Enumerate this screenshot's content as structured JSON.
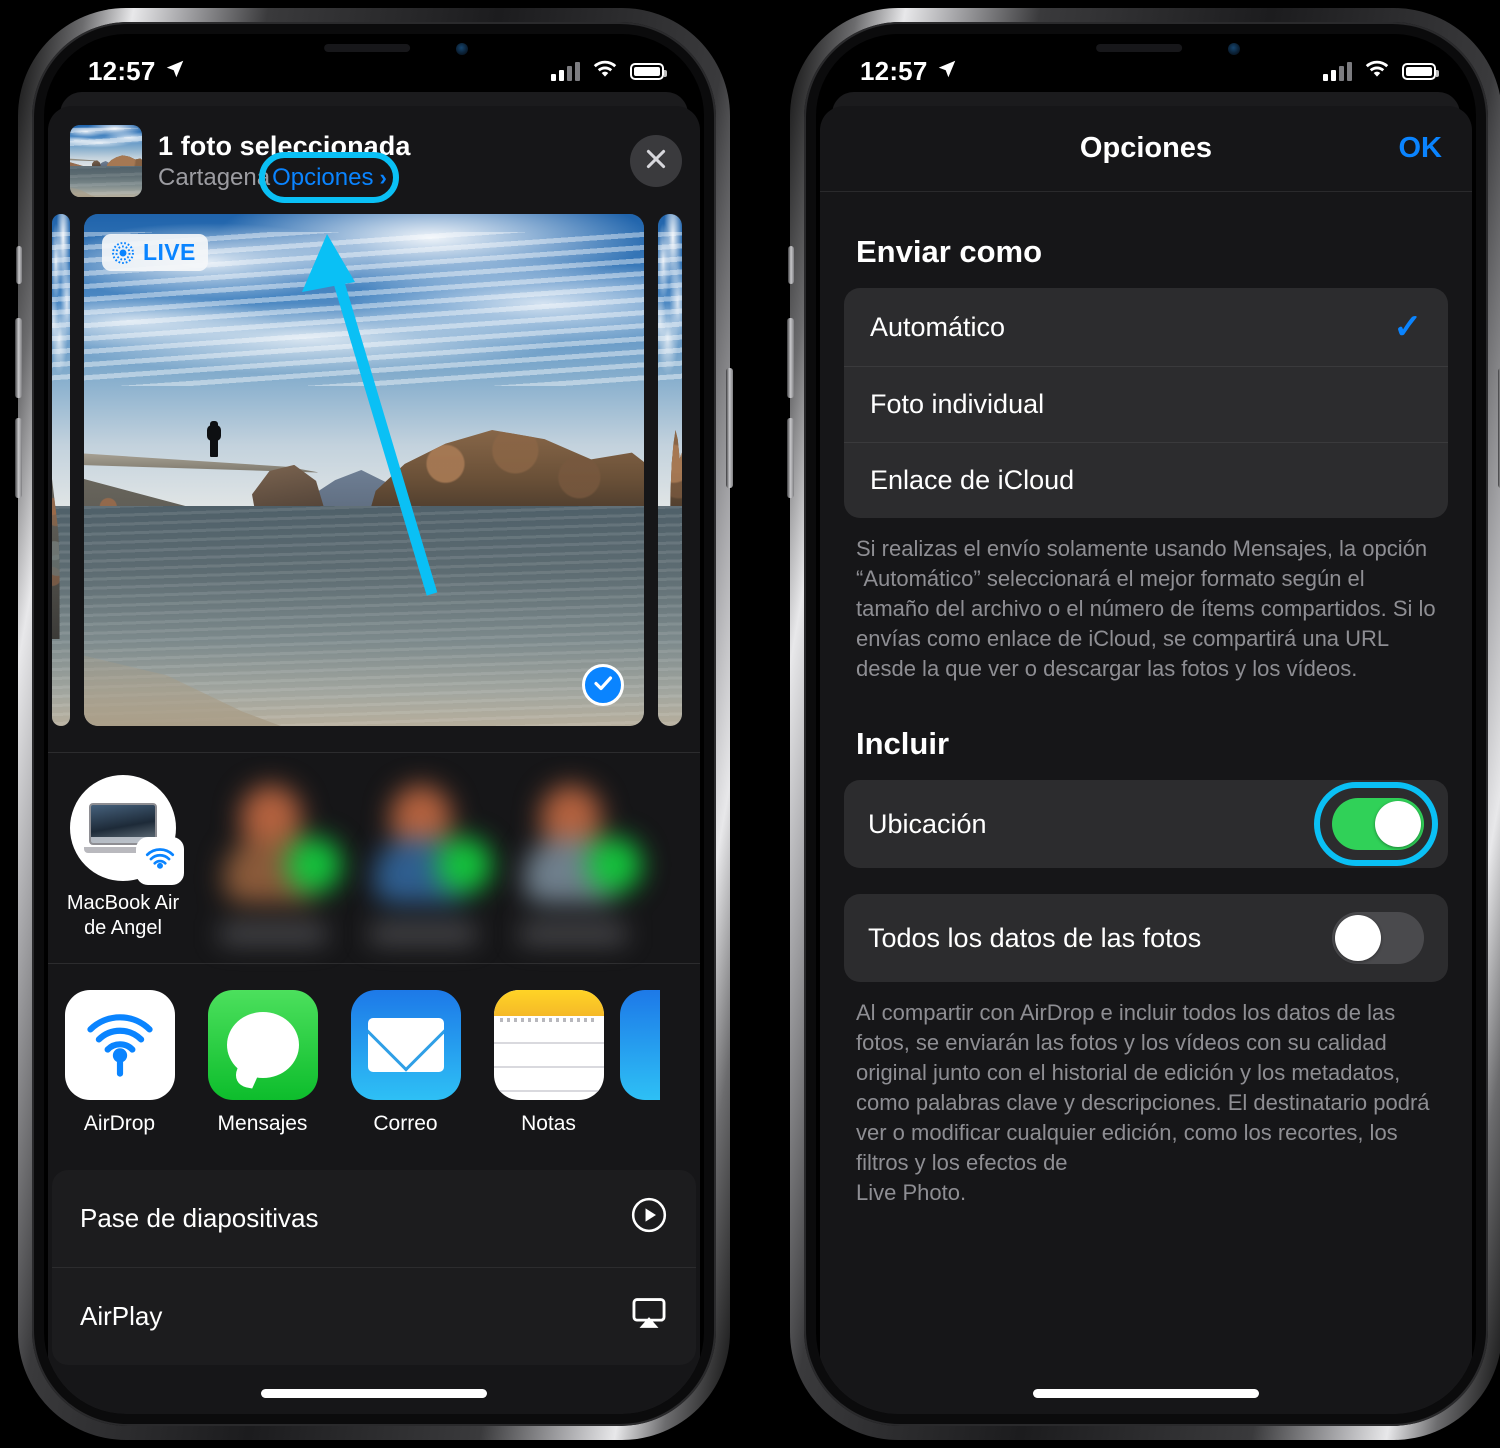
{
  "status_bar": {
    "time": "12:57",
    "location_icon": "location-arrow-icon",
    "signal_icon": "cellular-signal-icon",
    "wifi_icon": "wifi-icon",
    "battery_icon": "battery-icon"
  },
  "colors": {
    "accent_blue": "#0a84ff",
    "highlight_cyan": "#0ac0f5",
    "toggle_green": "#30d158",
    "sheet_bg": "#161618",
    "group_bg": "#2c2c2e",
    "secondary_text": "#8e8e93"
  },
  "share_sheet": {
    "title": "1 foto seleccionada",
    "subtitle": "Cartagena",
    "options_label": "Opciones",
    "options_chevron": "›",
    "close_icon": "close-icon",
    "photo": {
      "live_badge": "LIVE",
      "live_icon": "live-photo-icon",
      "selected_icon": "checkmark-circle-icon",
      "alt": "Playa con espigón de piedra, persona de pie y acantilado rocoso"
    },
    "airdrop": {
      "device_name": "MacBook Air\nde Angel",
      "device_icon": "macbook-icon",
      "airdrop_badge_icon": "airdrop-icon",
      "blurred_contacts": 3
    },
    "apps": [
      {
        "label": "AirDrop",
        "icon": "airdrop-icon"
      },
      {
        "label": "Mensajes",
        "icon": "messages-icon"
      },
      {
        "label": "Correo",
        "icon": "mail-icon"
      },
      {
        "label": "Notas",
        "icon": "notes-icon"
      }
    ],
    "actions": [
      {
        "label": "Pase de diapositivas",
        "icon": "play-circle-icon"
      },
      {
        "label": "AirPlay",
        "icon": "airplay-icon"
      }
    ]
  },
  "options_screen": {
    "nav": {
      "title": "Opciones",
      "done_label": "OK"
    },
    "send_as": {
      "heading": "Enviar como",
      "items": [
        {
          "label": "Automático",
          "selected": true,
          "check_icon": "checkmark-icon"
        },
        {
          "label": "Foto individual",
          "selected": false,
          "check_icon": ""
        },
        {
          "label": "Enlace de iCloud",
          "selected": false,
          "check_icon": ""
        }
      ],
      "footnote": "Si realizas el envío solamente usando Mensajes, la opción “Automático” seleccionará el mejor formato según el tamaño del archivo o el número de ítems compartidos. Si lo envías como enlace de iCloud, se compartirá una URL desde la que ver o descargar las fotos y los vídeos."
    },
    "include": {
      "heading": "Incluir",
      "items": [
        {
          "label": "Ubicación",
          "enabled": true,
          "highlighted": true
        },
        {
          "label": "Todos los datos de las fotos",
          "enabled": false,
          "highlighted": false
        }
      ],
      "footnote": "Al compartir con AirDrop e incluir todos los datos de las fotos, se enviarán las fotos y los vídeos con su calidad original junto con el historial de edición y los metadatos, como palabras clave y descripciones. El destinatario podrá ver o modificar cualquier edición, como los recortes, los filtros y los efectos de\nLive Photo."
    }
  },
  "annotation": {
    "arrow_icon": "pointer-arrow-icon",
    "arrow_color": "#0ac0f5",
    "targets": [
      "Opciones",
      "Ubicación"
    ]
  }
}
